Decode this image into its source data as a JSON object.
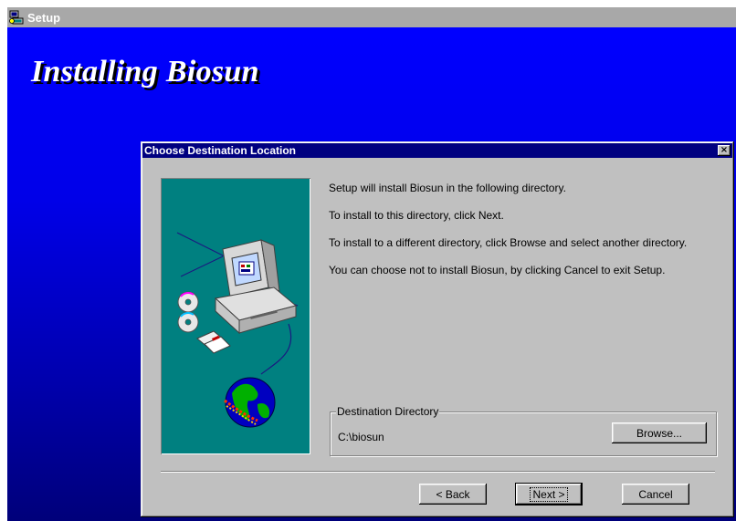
{
  "window": {
    "title": "Setup",
    "heading": "Installing Biosun"
  },
  "dialog": {
    "title": "Choose Destination Location",
    "close_symbol": "×",
    "messages": [
      "Setup will install Biosun in the following directory.",
      "To install to this directory, click Next.",
      "To install to a different directory, click Browse and select another directory.",
      "You can choose not to install Biosun, by clicking Cancel to exit Setup."
    ],
    "destination": {
      "group_label": "Destination Directory",
      "path": "C:\\biosun",
      "browse_label": "Browse...",
      "browse_mnemonic": "r"
    },
    "buttons": {
      "back_label": "< Back",
      "next_label": "Next >",
      "cancel_label": "Cancel"
    },
    "illustration": "computer-cd-globe-illustration"
  },
  "colors": {
    "title_bar_active": "#000080",
    "backdrop_top": "#0000ff",
    "backdrop_bottom": "#00007a",
    "illustration_bg": "#008080",
    "dialog_face": "#c0c0c0"
  }
}
